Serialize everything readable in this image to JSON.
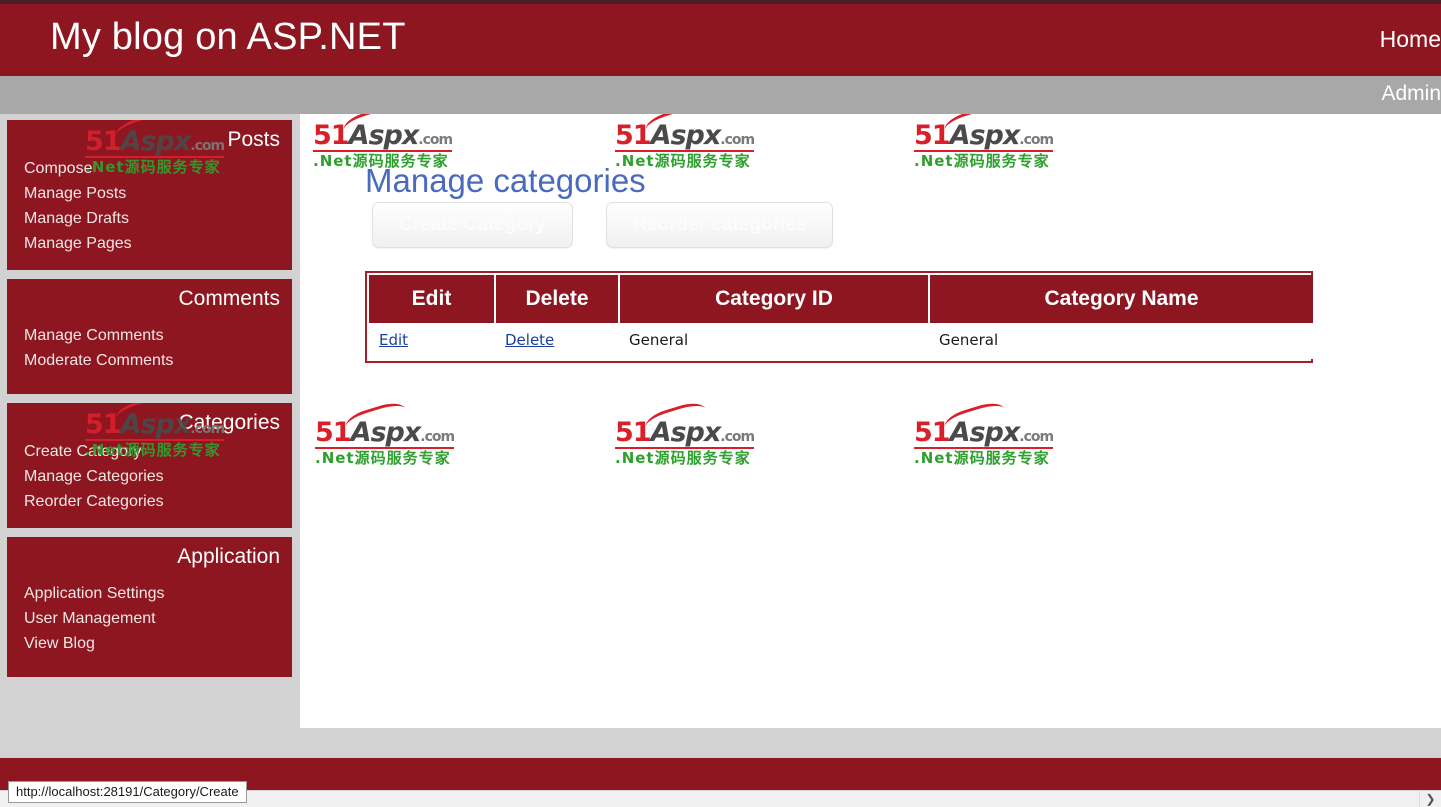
{
  "header": {
    "site_title": "My blog on ASP.NET",
    "nav_items": [
      {
        "label": "Home",
        "name": "nav-home"
      }
    ],
    "brand_color": "#8d1620"
  },
  "subnav": {
    "items": [
      {
        "label": "Admin",
        "name": "subnav-admin"
      }
    ],
    "bar_color": "#a8a8a8"
  },
  "sidebar": {
    "panels": [
      {
        "title": "Posts",
        "name": "sidebar-panel-posts",
        "links": [
          {
            "label": "Compose",
            "name": "sidebar-item-compose"
          },
          {
            "label": "Manage Posts",
            "name": "sidebar-item-manage-posts"
          },
          {
            "label": "Manage Drafts",
            "name": "sidebar-item-manage-drafts"
          },
          {
            "label": "Manage Pages",
            "name": "sidebar-item-manage-pages"
          }
        ]
      },
      {
        "title": "Comments",
        "name": "sidebar-panel-comments",
        "links": [
          {
            "label": "Manage Comments",
            "name": "sidebar-item-manage-comments"
          },
          {
            "label": "Moderate Comments",
            "name": "sidebar-item-moderate-comments"
          }
        ]
      },
      {
        "title": "Categories",
        "name": "sidebar-panel-categories",
        "links": [
          {
            "label": "Create Category",
            "name": "sidebar-item-create-category"
          },
          {
            "label": "Manage Categories",
            "name": "sidebar-item-manage-categories"
          },
          {
            "label": "Reorder Categories",
            "name": "sidebar-item-reorder-categories"
          }
        ]
      },
      {
        "title": "Application",
        "name": "sidebar-panel-application",
        "links": [
          {
            "label": "Application Settings",
            "name": "sidebar-item-application-settings"
          },
          {
            "label": "User Management",
            "name": "sidebar-item-user-management"
          },
          {
            "label": "View Blog",
            "name": "sidebar-item-view-blog"
          }
        ]
      }
    ]
  },
  "main": {
    "page_title": "Manage categories",
    "title_color": "#4a6bbd",
    "buttons": [
      {
        "label": "Create Category",
        "name": "create-category-button"
      },
      {
        "label": "Reorder categories",
        "name": "reorder-categories-button"
      }
    ],
    "table": {
      "headers": [
        "Edit",
        "Delete",
        "Category ID",
        "Category Name"
      ],
      "rows": [
        {
          "edit_label": "Edit",
          "delete_label": "Delete",
          "category_id": "General",
          "category_name": "General"
        }
      ]
    }
  },
  "watermark": {
    "line1_51": "51",
    "line1_aspx": "Aspx",
    "line1_com": ".com",
    "line2": ".Net源码服务专家"
  },
  "status": {
    "url": "http://localhost:28191/Category/Create"
  },
  "scrollbar": {
    "right_arrow": "❯"
  }
}
